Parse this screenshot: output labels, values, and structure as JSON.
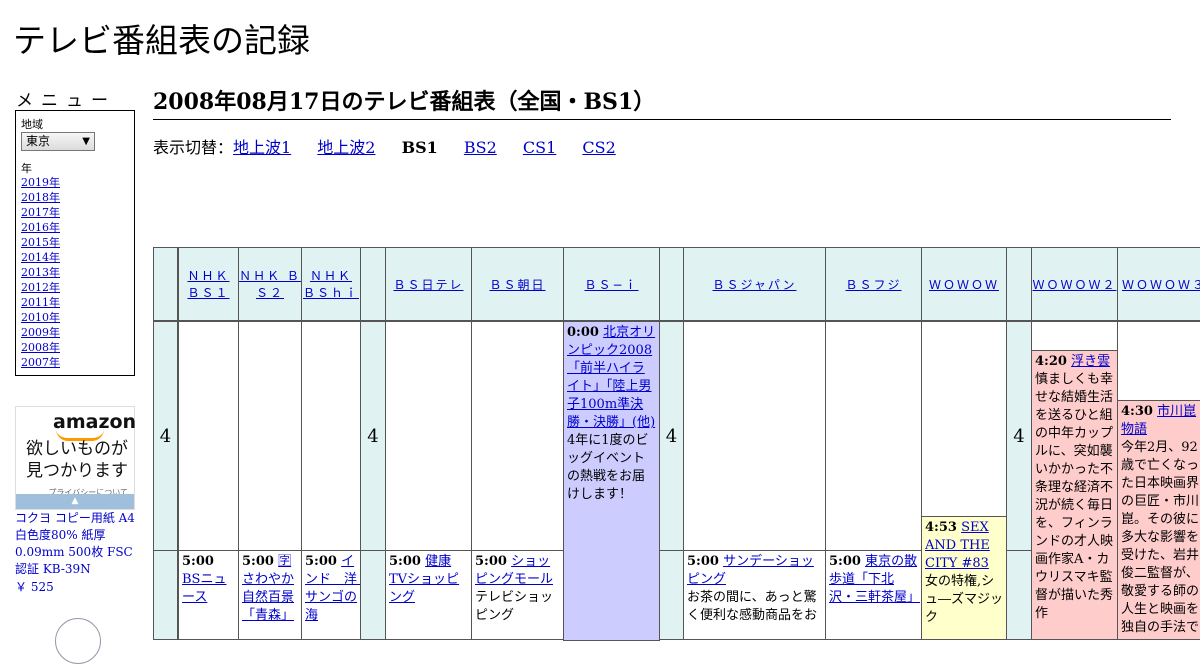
{
  "site_title": "テレビ番組表の記録",
  "menu": {
    "title": "メニュー",
    "region_label": "地域",
    "region_value": "東京",
    "year_label": "年",
    "years": [
      "2019年",
      "2018年",
      "2017年",
      "2016年",
      "2015年",
      "2014年",
      "2013年",
      "2012年",
      "2011年",
      "2010年",
      "2009年",
      "2008年",
      "2007年"
    ]
  },
  "ad": {
    "logo": "amazon",
    "tagline1": "欲しいものが",
    "tagline2": "見つかります",
    "privacy": "プライバシーについて",
    "product": "コクヨ コピー用紙 A4 白色度80% 紙厚 0.09mm 500枚 FSC認証 KB-39N",
    "price": "￥ 525"
  },
  "heading": "2008年08月17日のテレビ番組表（全国・BS1）",
  "switcher": {
    "label": "表示切替：",
    "items": [
      "地上波1",
      "地上波2",
      "BS1",
      "BS2",
      "CS1",
      "CS2"
    ],
    "current": "BS1"
  },
  "hour": "4",
  "channels": [
    "ＮＨＫ ＢＳ１",
    "ＮＨＫ ＢＳ２",
    "ＮＨＫ ＢＳｈｉ",
    "ＢＳ日テレ",
    "ＢＳ朝日",
    "ＢＳ−ｉ",
    "ＢＳジャパン",
    "ＢＳフジ",
    "ＷＯＷＯＷ",
    "ＷＯＷＯＷ２",
    "ＷＯＷＯＷ３"
  ],
  "programs": {
    "bsi_0000": {
      "time": "0:00",
      "title": "北京オリンピック2008「前半ハイライト」「陸上男子100m準決勝・決勝」(他)",
      "desc": "4年に1度のビッグイベントの熱戦をお届けします！"
    },
    "wowow2_0420": {
      "time": "4:20",
      "title": "浮き雲",
      "desc": "慎ましくも幸せな結婚生活を送るひと組の中年カップルに、突如襲いかかった不条理な経済不況が続く毎日を、フィンランドの才人映画作家A・カウリスマキ監督が描いた秀作"
    },
    "wowow3_0430": {
      "time": "4:30",
      "title": "市川崑物語",
      "desc": "今年2月、92歳で亡くなった日本映画界の巨匠・市川崑。その彼に多大な影響を受けた、岩井俊二監督が、敬愛する師の人生と映画を独自の手法で"
    },
    "wowow_0453": {
      "time": "4:53",
      "title": "SEX AND THE CITY #83",
      "desc": "女の特権,シュ―ズマジック"
    },
    "bs1_0500": {
      "time": "5:00",
      "title": "BSニュース",
      "desc": ""
    },
    "bs2_0500": {
      "time": "5:00",
      "title": "🈑さわやか自然百景「青森」",
      "desc": ""
    },
    "bshi_0500": {
      "time": "5:00",
      "title": "インド　洋　サンゴの海",
      "desc": ""
    },
    "bsntv_0500": {
      "time": "5:00",
      "title": "健康TVショッピング",
      "desc": ""
    },
    "bsasahi_0500": {
      "time": "5:00",
      "title": "ショッピングモール",
      "desc": "テレビショッピング"
    },
    "bsjapan_0500": {
      "time": "5:00",
      "title": "サンデーショッピング",
      "desc": "お茶の間に、あっと驚く便利な感動商品をお"
    },
    "bsfuji_0500": {
      "time": "5:00",
      "title": "東京の散歩道「下北沢・三軒茶屋」",
      "desc": ""
    }
  },
  "colors": {
    "header_bg": "#e0f2f2",
    "bsi_bg": "#ccccff",
    "wowow_yellow": "#ffffcc",
    "wowow_pink": "#ffcccc",
    "link": "#0000cc"
  }
}
